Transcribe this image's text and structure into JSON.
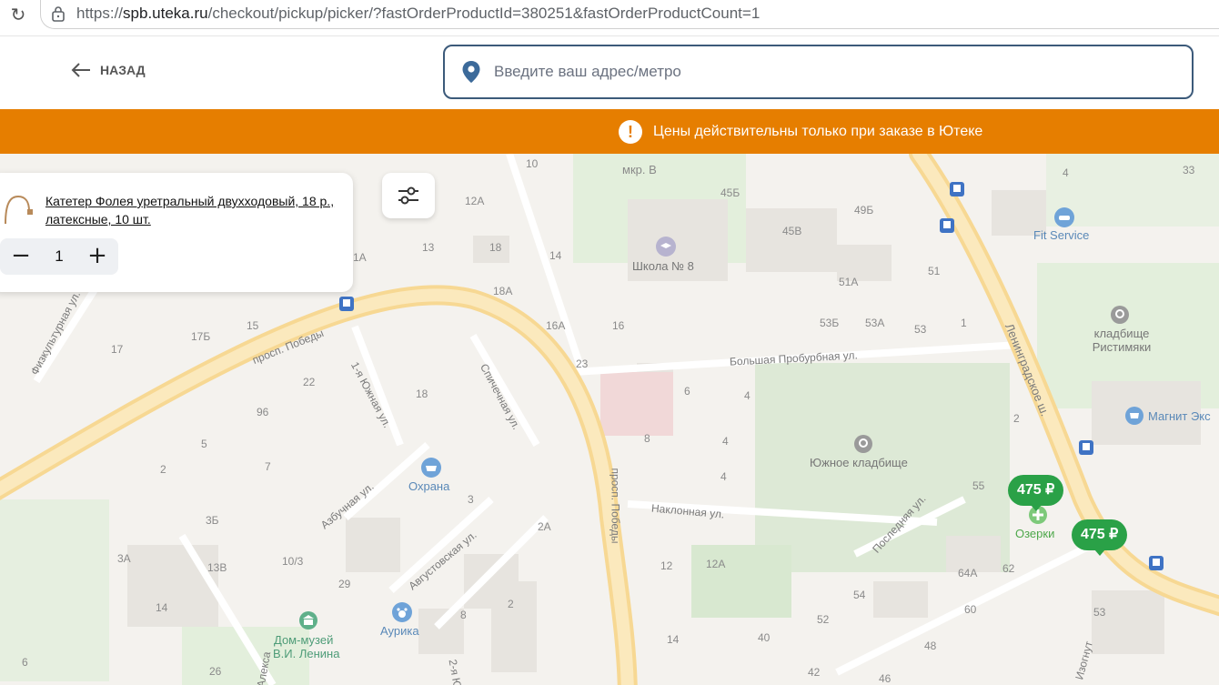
{
  "browser": {
    "url_prefix": "https://",
    "url_host": "spb.uteka.ru",
    "url_path": "/checkout/pickup/picker/?fastOrderProductId=380251&fastOrderProductCount=1"
  },
  "header": {
    "back_label": "НАЗАД",
    "address_placeholder": "Введите ваш адрес/метро"
  },
  "banner": {
    "text": "Цены действительны только при заказе в Ютеке"
  },
  "product": {
    "title": "Катетер Фолея уретральный двухходовый, 18 р., латексные, 10 шт.",
    "quantity": "1",
    "minus": "−",
    "plus": "+"
  },
  "map": {
    "prices": [
      "475 ₽",
      "475 ₽"
    ],
    "pois": {
      "school": "Школа № 8",
      "fit_service": "Fit Service",
      "cemetery_ristimyaki": "кладбище Ристимяки",
      "magnit": "Магнит Экс",
      "south_cemetery": "Южное кладбище",
      "ozerki": "Озерки",
      "okhrana": "Охрана",
      "aurika": "Аурика",
      "museum_line1": "Дом-музей",
      "museum_line2": "В.И. Ленина",
      "mkr": "мкр. В"
    },
    "streets": {
      "pobedy1": "просп. Победы",
      "pobedy2": "просп. Победы",
      "bolshaya": "Большая Пробурбная ул.",
      "leningrad": "Ленинградское ш.",
      "naklonnaya": "Наклонная ул.",
      "poslednyaya": "Последняя ул.",
      "avgustovskaya": "Августовская ул.",
      "azbuchnaya": "Азбучная ул.",
      "spichechnaya": "Спичечная ул.",
      "yuzhnaya1": "1-я Южная ул.",
      "fizkultur": "Физкультурная ул.",
      "izogn": "Изогнут",
      "aleks": "Алекса",
      "yu2": "2-я Ю"
    },
    "house_numbers": [
      "10",
      "45Б",
      "49Б",
      "4",
      "33",
      "12А",
      "13",
      "18",
      "18А",
      "14",
      "45В",
      "51",
      "51А",
      "53Б",
      "53А",
      "53",
      "1",
      "16А",
      "16",
      "23",
      "17Б",
      "17",
      "15",
      "1А",
      "22",
      "18",
      "6",
      "4",
      "4",
      "4",
      "8",
      "96",
      "5",
      "7",
      "2",
      "2",
      "3",
      "3Б",
      "2А",
      "55",
      "3А",
      "13В",
      "10/3",
      "29",
      "14",
      "2",
      "8",
      "12",
      "12А",
      "54",
      "64А",
      "62",
      "60",
      "53",
      "52",
      "48",
      "40",
      "42",
      "46",
      "26",
      "14",
      "6"
    ]
  }
}
